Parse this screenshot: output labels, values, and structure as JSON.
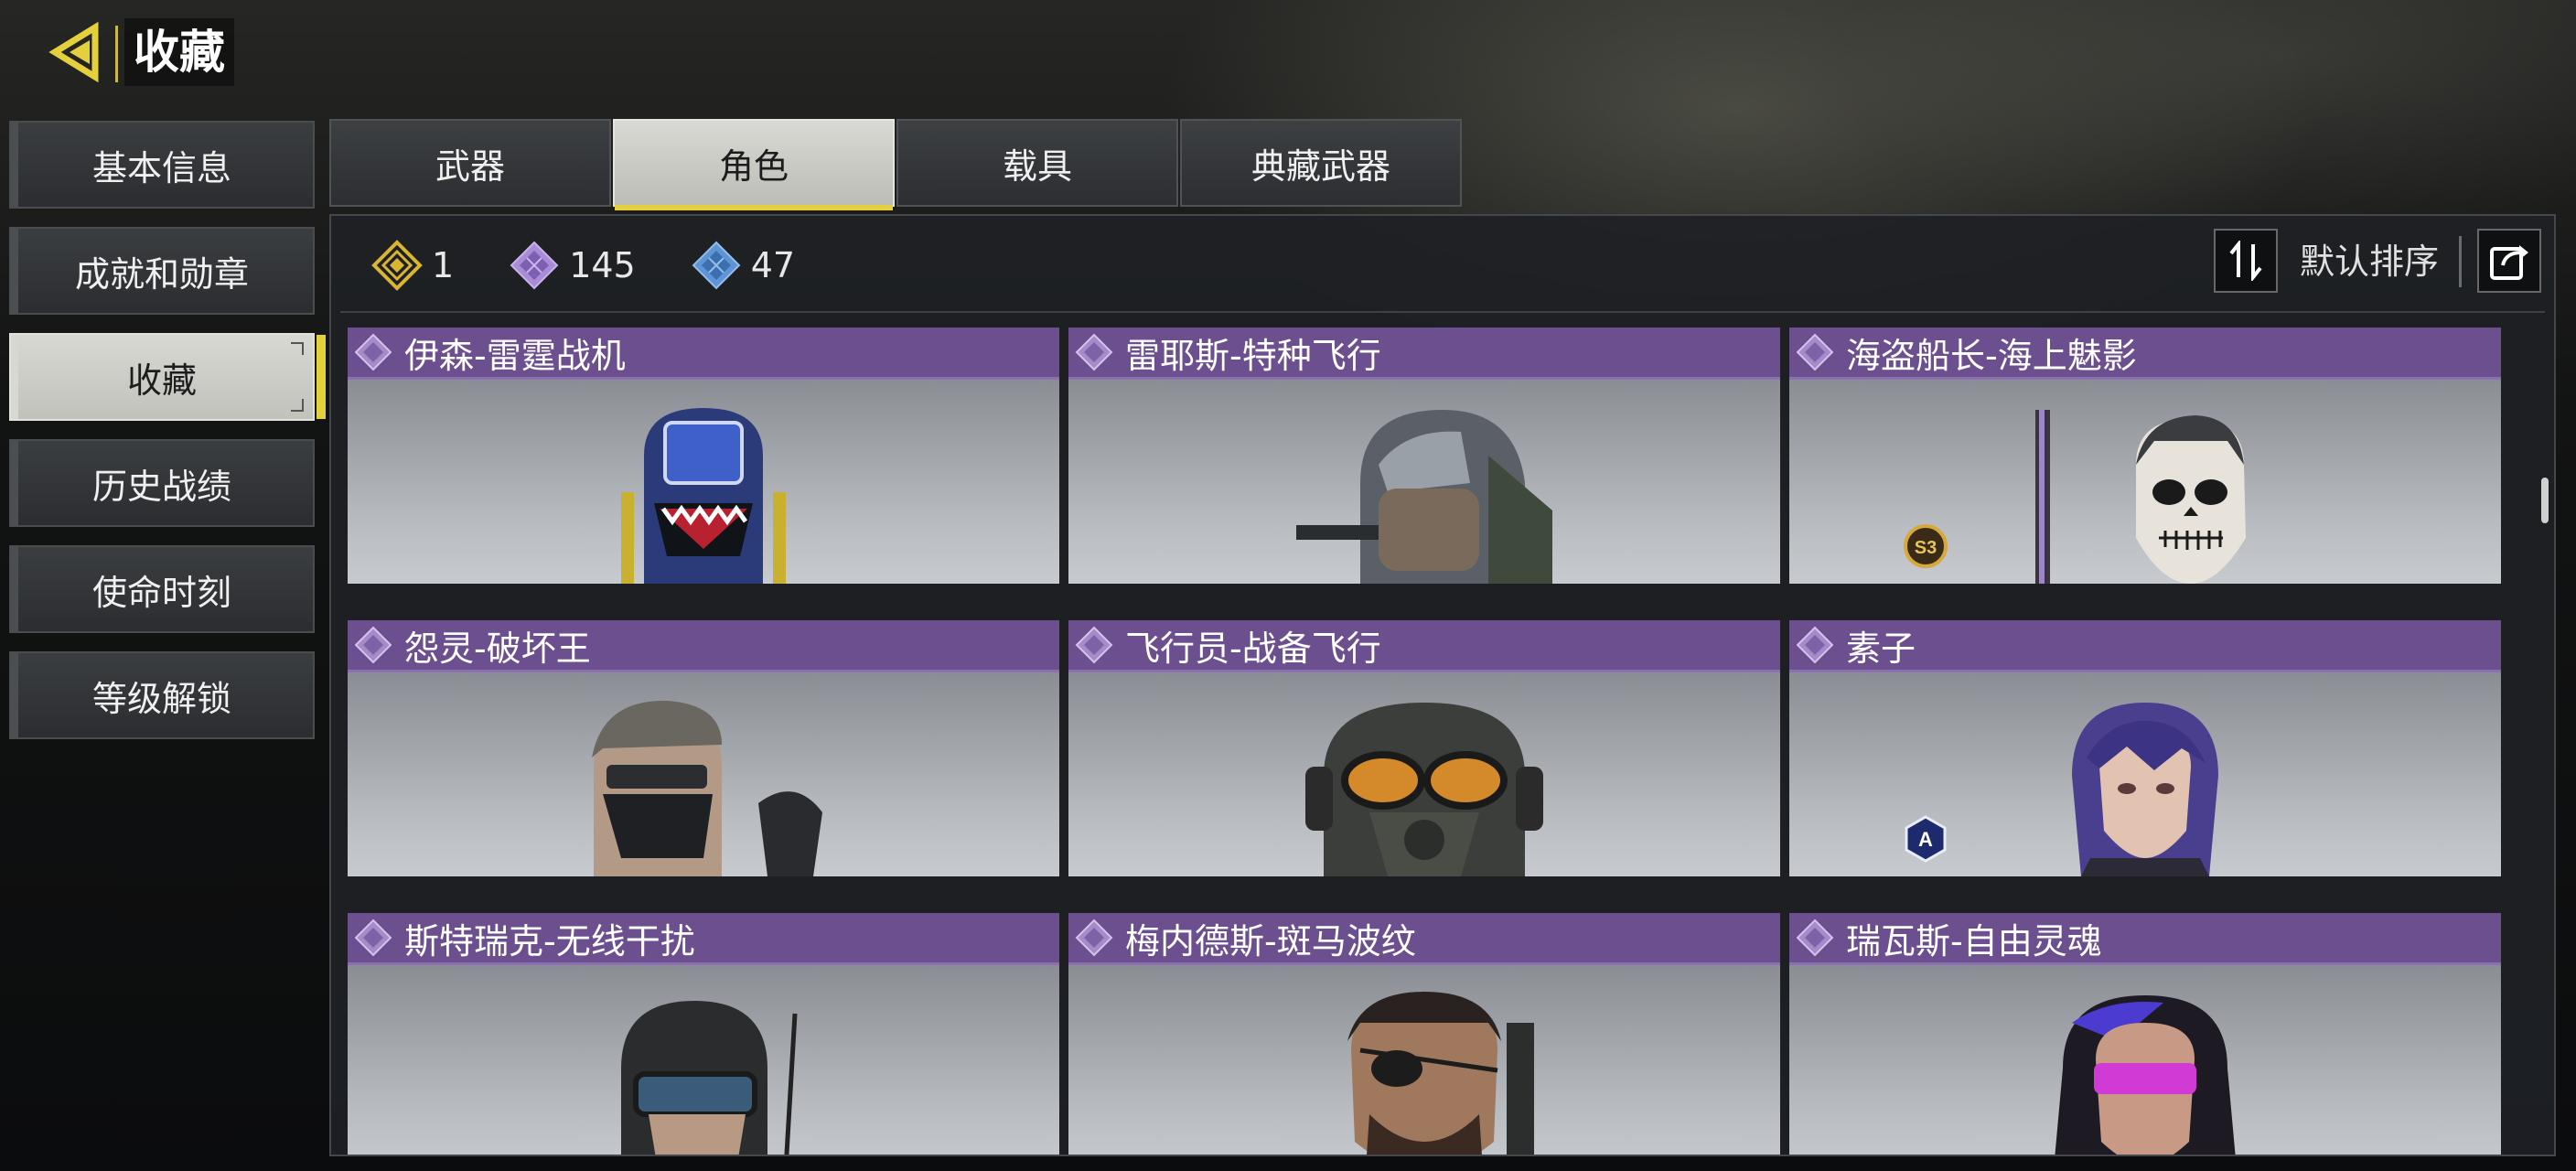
{
  "header": {
    "title": "收藏"
  },
  "sidebar": {
    "items": [
      {
        "label": "基本信息"
      },
      {
        "label": "成就和勋章"
      },
      {
        "label": "收藏"
      },
      {
        "label": "历史战绩"
      },
      {
        "label": "使命时刻"
      },
      {
        "label": "等级解锁"
      }
    ],
    "active_index": 2
  },
  "tabs": [
    {
      "label": "武器"
    },
    {
      "label": "角色"
    },
    {
      "label": "载具"
    },
    {
      "label": "典藏武器"
    }
  ],
  "active_tab_index": 1,
  "counts": [
    {
      "icon": "gold-diamond-icon",
      "value": "1",
      "color": "#d9b531"
    },
    {
      "icon": "purple-diamond-icon",
      "value": "145",
      "color": "#a98bd6"
    },
    {
      "icon": "blue-diamond-icon",
      "value": "47",
      "color": "#5d95d6"
    }
  ],
  "sort": {
    "label": "默认排序"
  },
  "cards": [
    {
      "name": "伊森-雷霆战机",
      "rarity": "purple"
    },
    {
      "name": "雷耶斯-特种飞行",
      "rarity": "purple"
    },
    {
      "name": "海盗船长-海上魅影",
      "rarity": "purple",
      "badge": "S3"
    },
    {
      "name": "怨灵-破坏王",
      "rarity": "purple"
    },
    {
      "name": "飞行员-战备飞行",
      "rarity": "purple"
    },
    {
      "name": "素子",
      "rarity": "purple",
      "badge": "A"
    },
    {
      "name": "斯特瑞克-无线干扰",
      "rarity": "purple"
    },
    {
      "name": "梅内德斯-斑马波纹",
      "rarity": "purple"
    },
    {
      "name": "瑞瓦斯-自由灵魂",
      "rarity": "purple"
    }
  ],
  "colors": {
    "accent_yellow": "#e4cf3c",
    "card_header_purple": "#6c4f8f",
    "active_tab_bg": "#d9d9d4"
  }
}
